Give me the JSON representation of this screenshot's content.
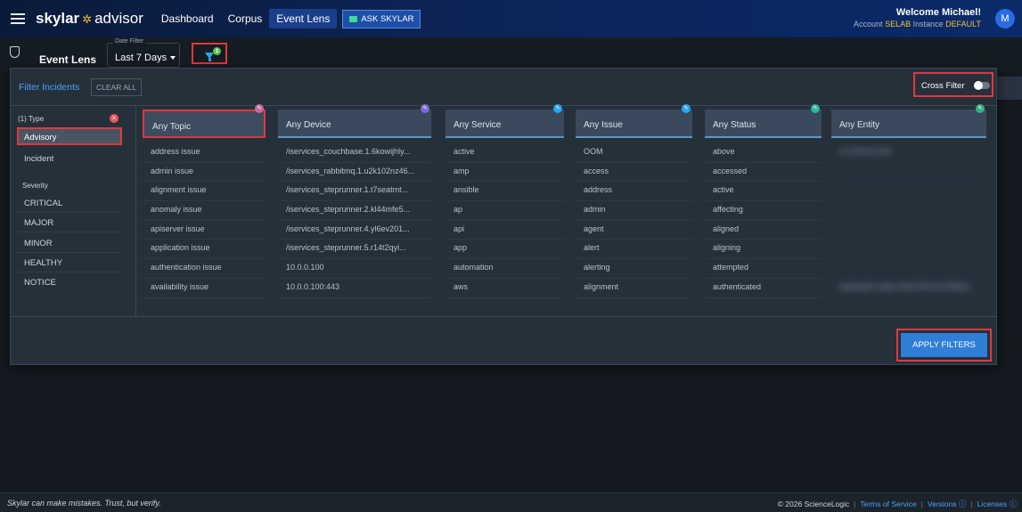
{
  "app": {
    "logo_brand": "skylar",
    "logo_product": "advisor",
    "nav": [
      "Dashboard",
      "Corpus",
      "Event Lens"
    ],
    "ask_label": "ASK SKYLAR",
    "welcome": "Welcome Michael!",
    "account_label": "Account",
    "account_value": "SELAB",
    "instance_label": "Instance",
    "instance_value": "DEFAULT",
    "avatar": "M"
  },
  "header": {
    "title": "Event Lens",
    "date_filter_label": "Date Filter",
    "date_filter_value": "Last 7 Days",
    "filter_badge": "1"
  },
  "panel": {
    "title": "Filter Incidents",
    "clear_all": "CLEAR ALL",
    "cross_filter": "Cross Filter",
    "type_header": "(1) Type",
    "types": [
      "Advisory",
      "Incident"
    ],
    "severity_header": "Severity",
    "severities": [
      "CRITICAL",
      "MAJOR",
      "MINOR",
      "HEALTHY",
      "NOTICE"
    ],
    "apply": "APPLY FILTERS"
  },
  "columns": [
    {
      "header": "Any Topic",
      "items": [
        "address issue",
        "admin issue",
        "alignment issue",
        "anomaly issue",
        "apiserver issue",
        "application issue",
        "authentication issue",
        "availability issue"
      ]
    },
    {
      "header": "Any Device",
      "items": [
        "/iservices_couchbase.1.6kowijhly...",
        "/iservices_rabbitmq.1.u2k102nz46...",
        "/iservices_steprunner.1.t7seatmt...",
        "/iservices_steprunner.2.kl44mfe5...",
        "/iservices_steprunner.4.yl6ev201...",
        "/iservices_steprunner.5.r14t2qyi...",
        "10.0.0.100",
        "10.0.0.100:443"
      ]
    },
    {
      "header": "Any Service",
      "items": [
        "active",
        "amp",
        "ansible",
        "ap",
        "api",
        "app",
        "automation",
        "aws"
      ]
    },
    {
      "header": "Any Issue",
      "items": [
        "OOM",
        "access",
        "address",
        "admin",
        "agent",
        "alert",
        "alerting",
        "alignment"
      ]
    },
    {
      "header": "Any Status",
      "items": [
        "above",
        "accessed",
        "active",
        "affecting",
        "aligned",
        "aligning",
        "attempted",
        "authenticated"
      ]
    },
    {
      "header": "Any Entity",
      "items": [
        "10.100.00.100",
        "",
        "",
        "",
        "",
        "",
        "",
        "9de9edd7-bdda-4cb5-87b-b17b3b01..."
      ]
    }
  ],
  "footer": {
    "disclaimer": "Skylar can make mistakes. Trust, but verify.",
    "copyright": "© 2026 ScienceLogic",
    "terms": "Terms of Service",
    "versions": "Versions ⓘ",
    "licenses": "Licenses ⓘ"
  },
  "colors": {
    "accent": "#2f7ed8",
    "highlight": "#e0383e",
    "badge_green": "#5cc34a"
  }
}
